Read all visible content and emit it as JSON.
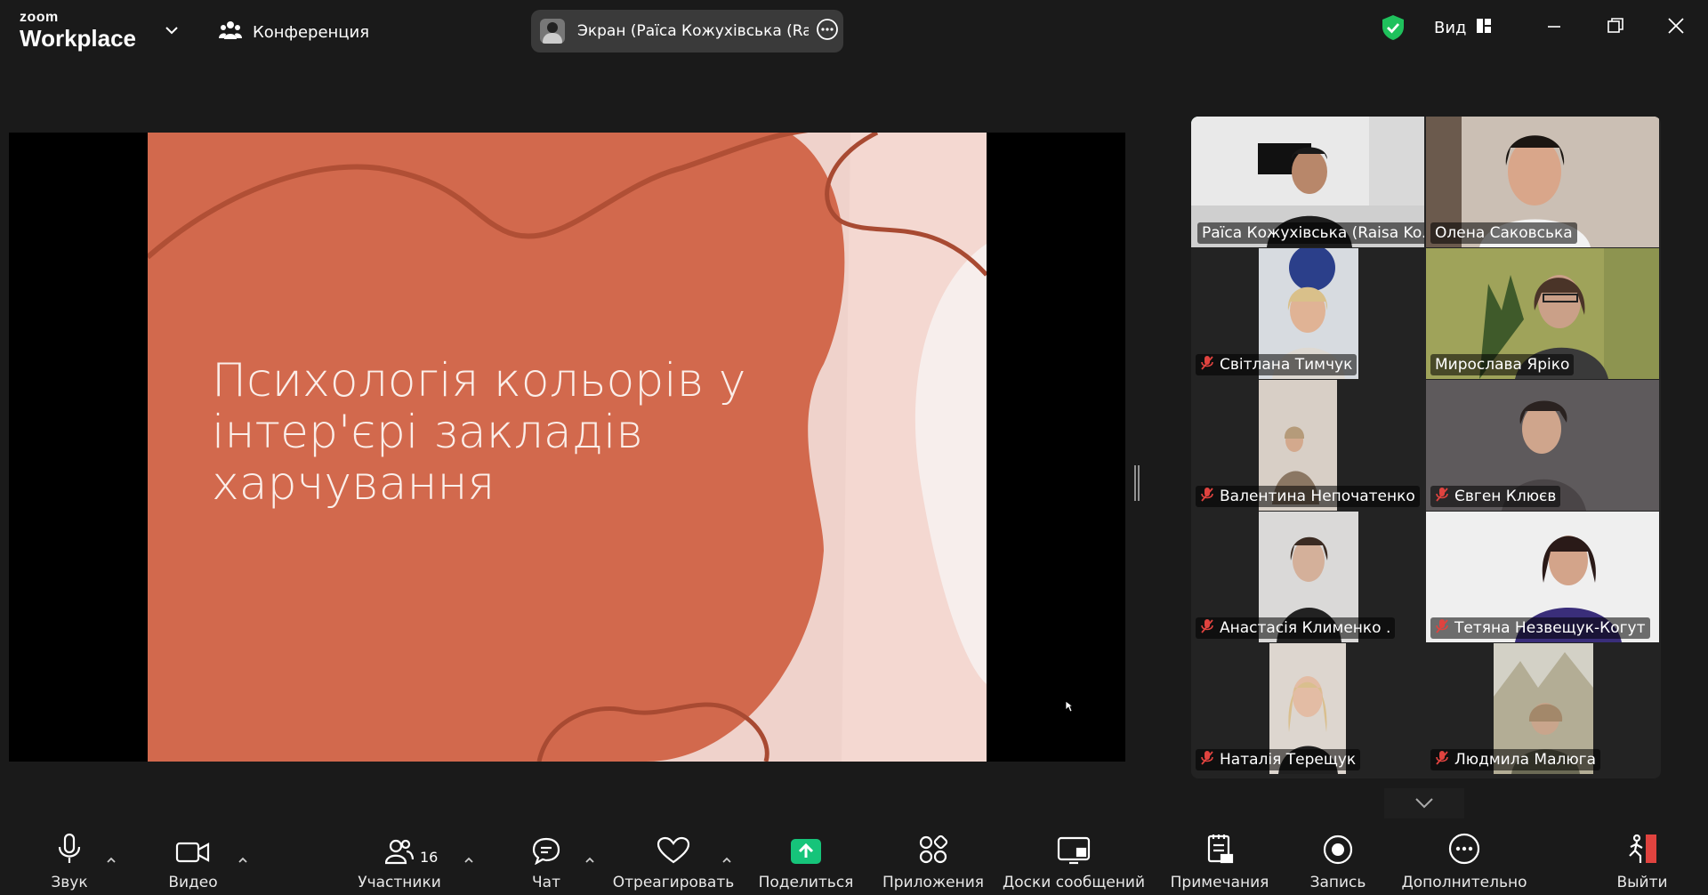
{
  "app": {
    "logo_top": "zoom",
    "logo_bottom": "Workplace"
  },
  "header": {
    "meeting_label": "Конференция",
    "screen_share_label": "Экран (Раїса Кожухівська (Raisa",
    "view_label": "Вид"
  },
  "slide": {
    "title_line1": "Психологія кольорів у",
    "title_line2": "інтер'єрі закладів",
    "title_line3": "харчування"
  },
  "colors": {
    "accent_green": "#23d09a",
    "share_green": "#16c47a",
    "slide_orange": "#d2694d",
    "slide_pink": "#efd2cb",
    "muted_red": "#e0433f"
  },
  "participants": [
    {
      "name": "Раїса Кожухівська (Raisa Ko...",
      "muted": false,
      "active": true
    },
    {
      "name": "Олена Саковська",
      "muted": false,
      "active": false
    },
    {
      "name": "Світлана Тимчук",
      "muted": true,
      "active": false
    },
    {
      "name": "Мирослава Ярiко",
      "muted": false,
      "active": false
    },
    {
      "name": "Валентина Непочатенко",
      "muted": true,
      "active": false
    },
    {
      "name": "Євген Клюєв",
      "muted": true,
      "active": false
    },
    {
      "name": "Анастасія Клименко .",
      "muted": true,
      "active": false
    },
    {
      "name": "Тетяна Незвещук-Когут",
      "muted": true,
      "active": false
    },
    {
      "name": "Наталія Терещук",
      "muted": true,
      "active": false
    },
    {
      "name": "Людмила Малюга",
      "muted": true,
      "active": false
    }
  ],
  "toolbar": {
    "audio": "Звук",
    "video": "Видео",
    "participants": "Участники",
    "participants_count": "16",
    "chat": "Чат",
    "react": "Отреагировать",
    "share": "Поделиться",
    "apps": "Приложения",
    "boards": "Доски сообщений",
    "notes": "Примечания",
    "record": "Запись",
    "more": "Дополнительно",
    "leave": "Выйти"
  }
}
